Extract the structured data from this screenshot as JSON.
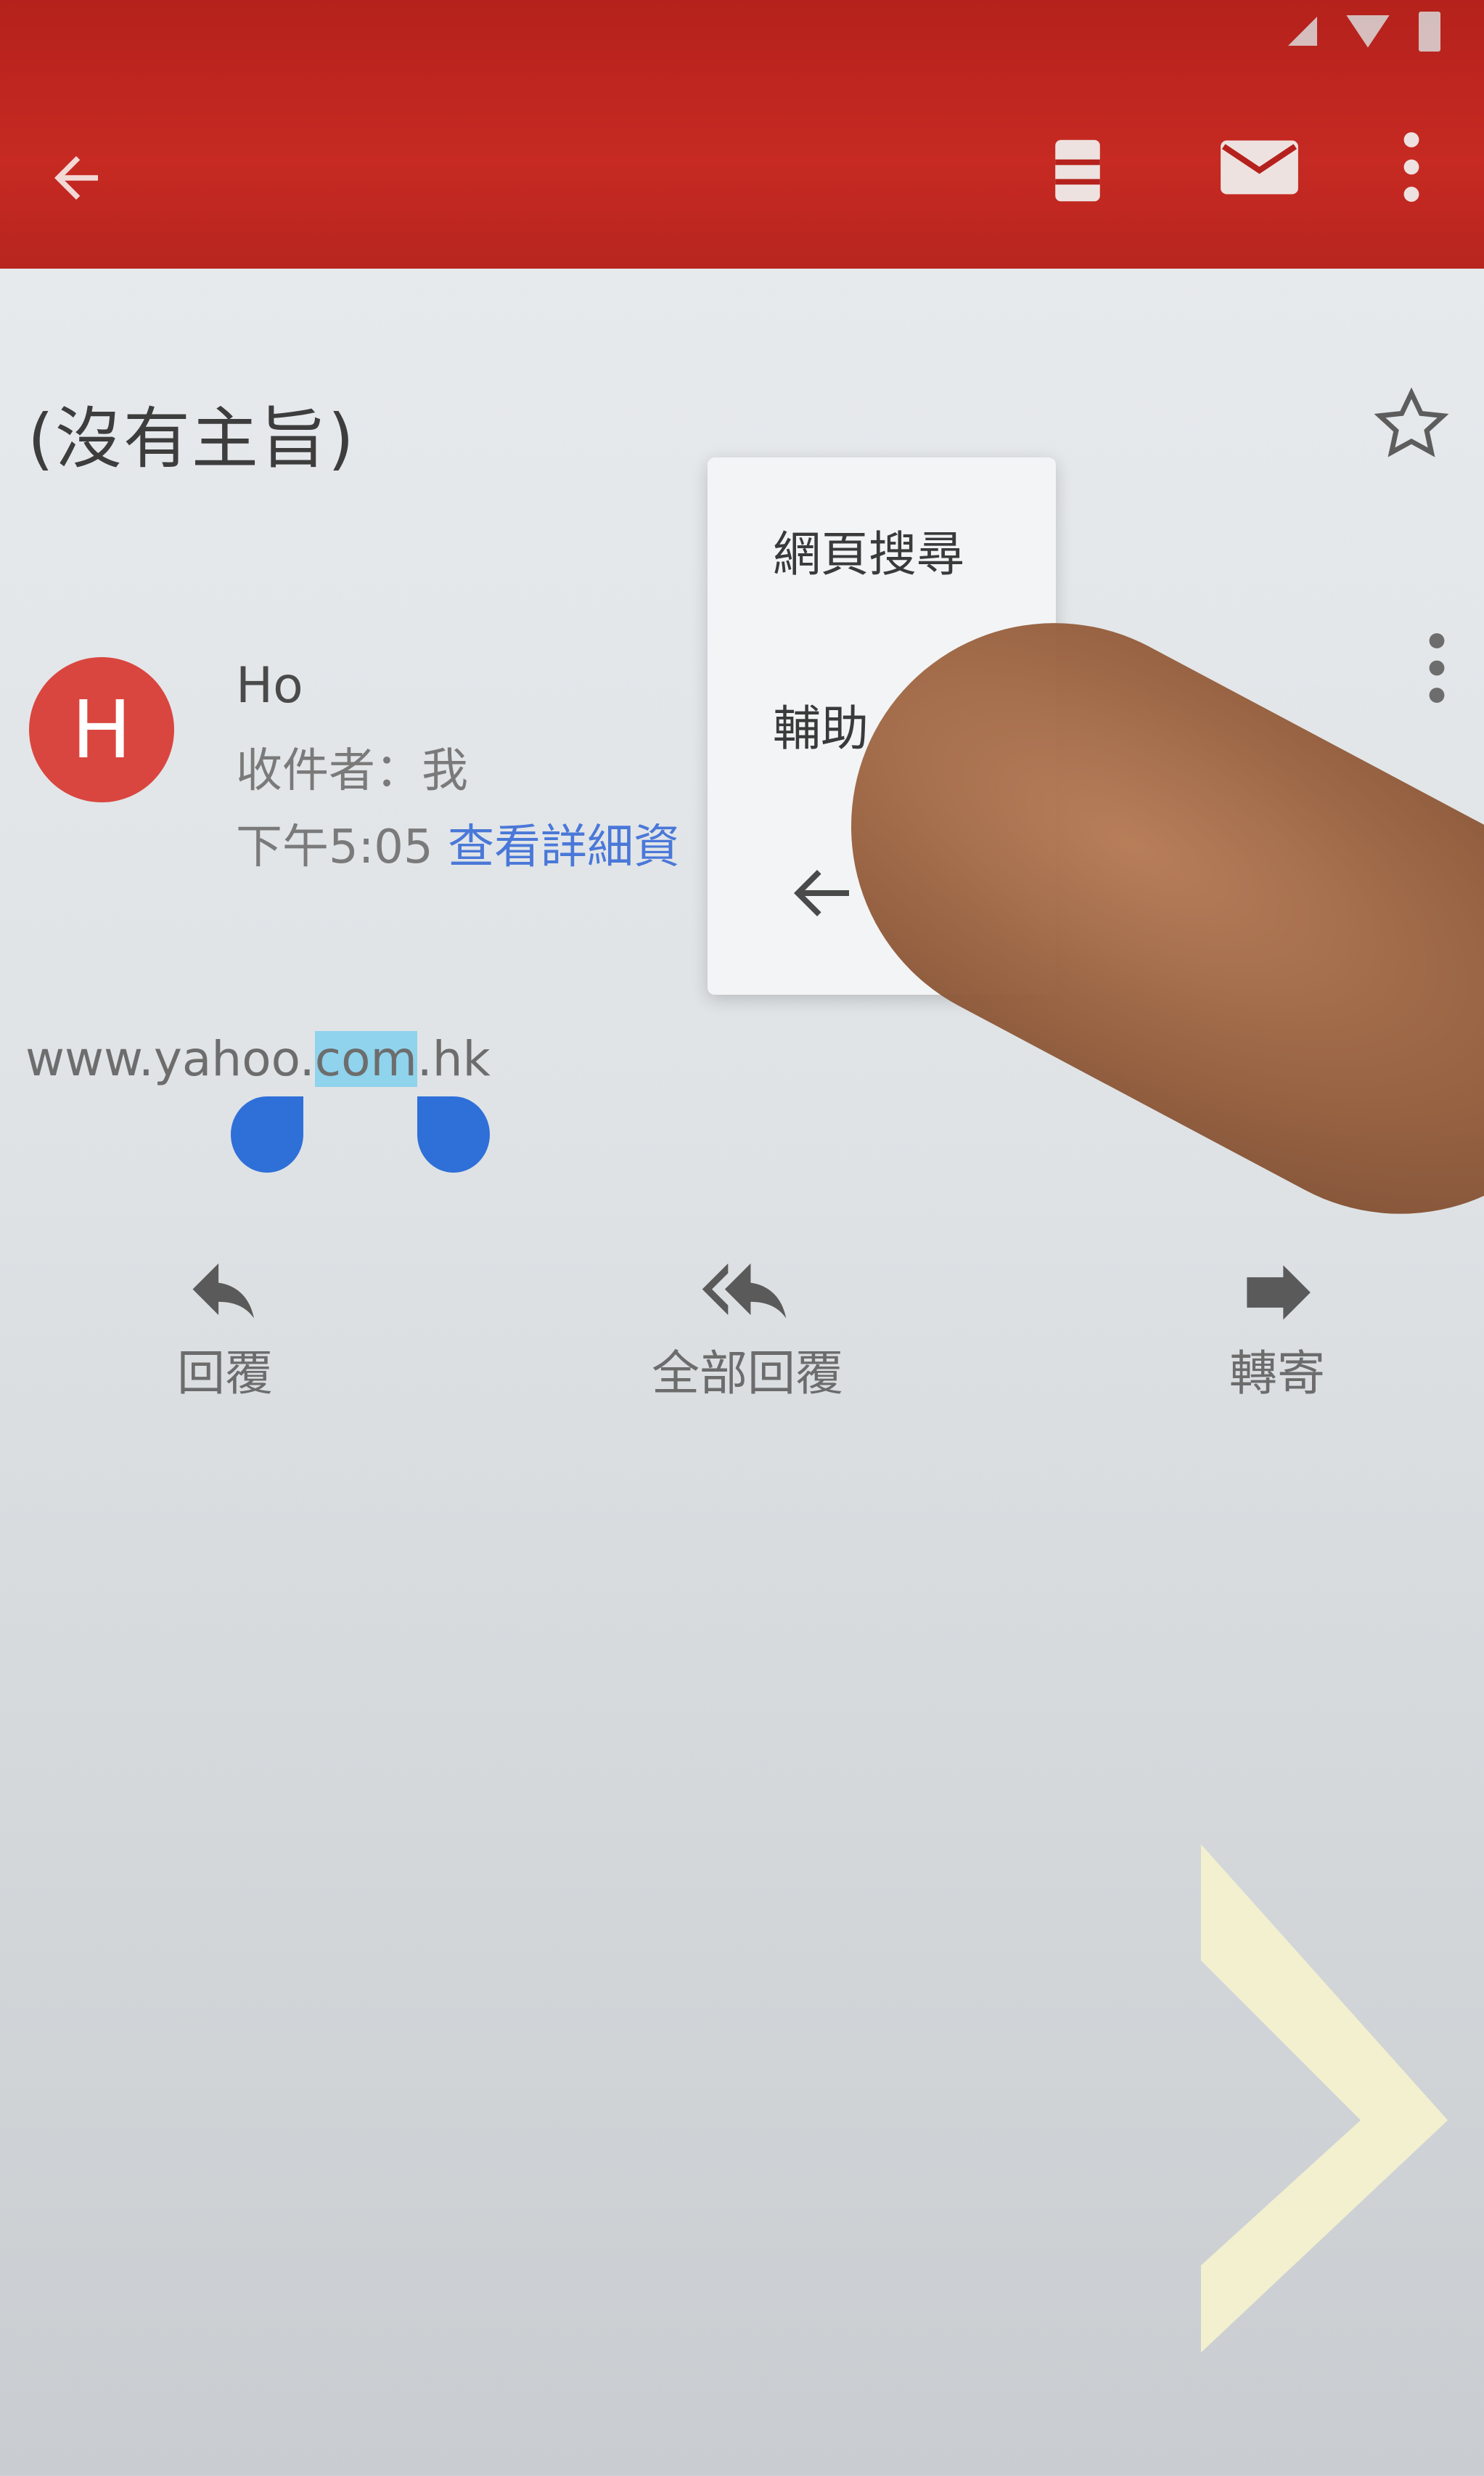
{
  "app_bar": {
    "back_icon": "arrow-back-icon",
    "archive_icon": "archive-icon",
    "mail_icon": "mail-icon",
    "more_icon": "more-vert-icon",
    "color": "#c62a22"
  },
  "email": {
    "subject": "(沒有主旨)",
    "star_icon": "star-outline-icon",
    "sender_initial": "H",
    "sender_name": "Ho",
    "recipient": "收件者：我",
    "time": "下午5:05",
    "details_link": "查看詳細資",
    "body_prefix": "www.yahoo.",
    "body_selected": "com",
    "body_suffix": ".hk",
    "avatar_color": "#d9463f",
    "link_color": "#4a78d8",
    "selection_color": "#8fd3ec"
  },
  "context_menu": {
    "items": [
      "網頁搜尋",
      "輔助"
    ],
    "back_icon": "arrow-back-icon"
  },
  "actions": {
    "reply": "回覆",
    "reply_all": "全部回覆",
    "forward": "轉寄"
  }
}
